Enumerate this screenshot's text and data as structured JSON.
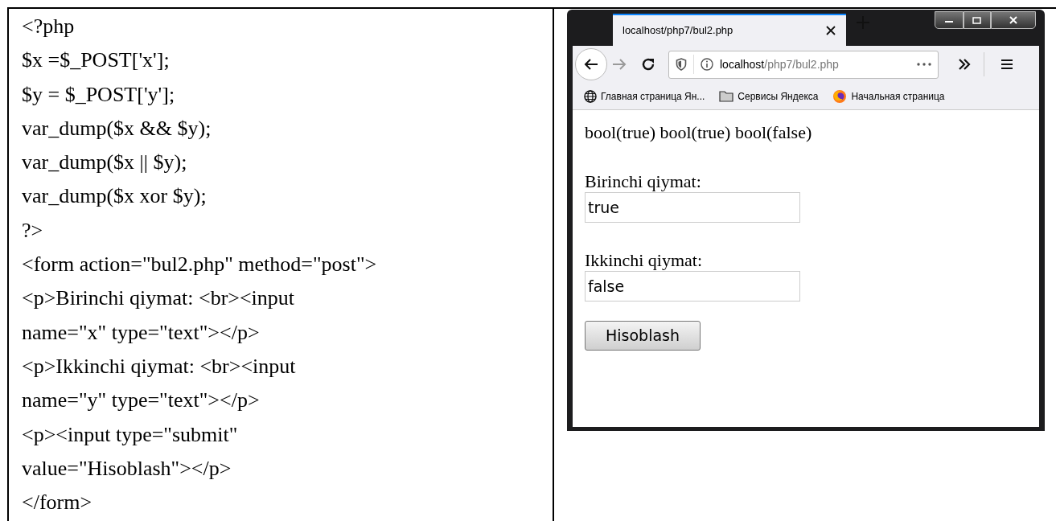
{
  "code_lines": [
    "<?php",
    "$x =$_POST['x'];",
    "$y = $_POST['y'];",
    "var_dump($x && $y);",
    "var_dump($x || $y);",
    "var_dump($x xor $y);",
    "?>",
    "<form action=\"bul2.php\" method=\"post\">",
    "<p>Birinchi qiymat: <br><input",
    "name=\"x\" type=\"text\"></p>",
    "<p>Ikkinchi qiymat: <br><input",
    "name=\"y\" type=\"text\"></p>",
    "<p><input type=\"submit\"",
    "value=\"Hisoblash\"></p>",
    "</form>"
  ],
  "browser": {
    "tabs": [
      {
        "title": "localhost/php7/bul2.php",
        "selected": true
      }
    ],
    "forward_disabled": true,
    "address": {
      "host": "localhost",
      "path": "/php7/bul2.php"
    },
    "bookmarks": [
      {
        "kind": "globe",
        "label": "Главная страница Ян..."
      },
      {
        "kind": "folder",
        "label": "Сервисы Яндекса"
      },
      {
        "kind": "firefox",
        "label": "Начальная страница"
      }
    ],
    "page": {
      "output": "bool(true) bool(true) bool(false)",
      "fields": [
        {
          "label": "Birinchi qiymat:",
          "value": "true"
        },
        {
          "label": "Ikkinchi qiymat:",
          "value": "false"
        }
      ],
      "submit": "Hisoblash"
    }
  }
}
